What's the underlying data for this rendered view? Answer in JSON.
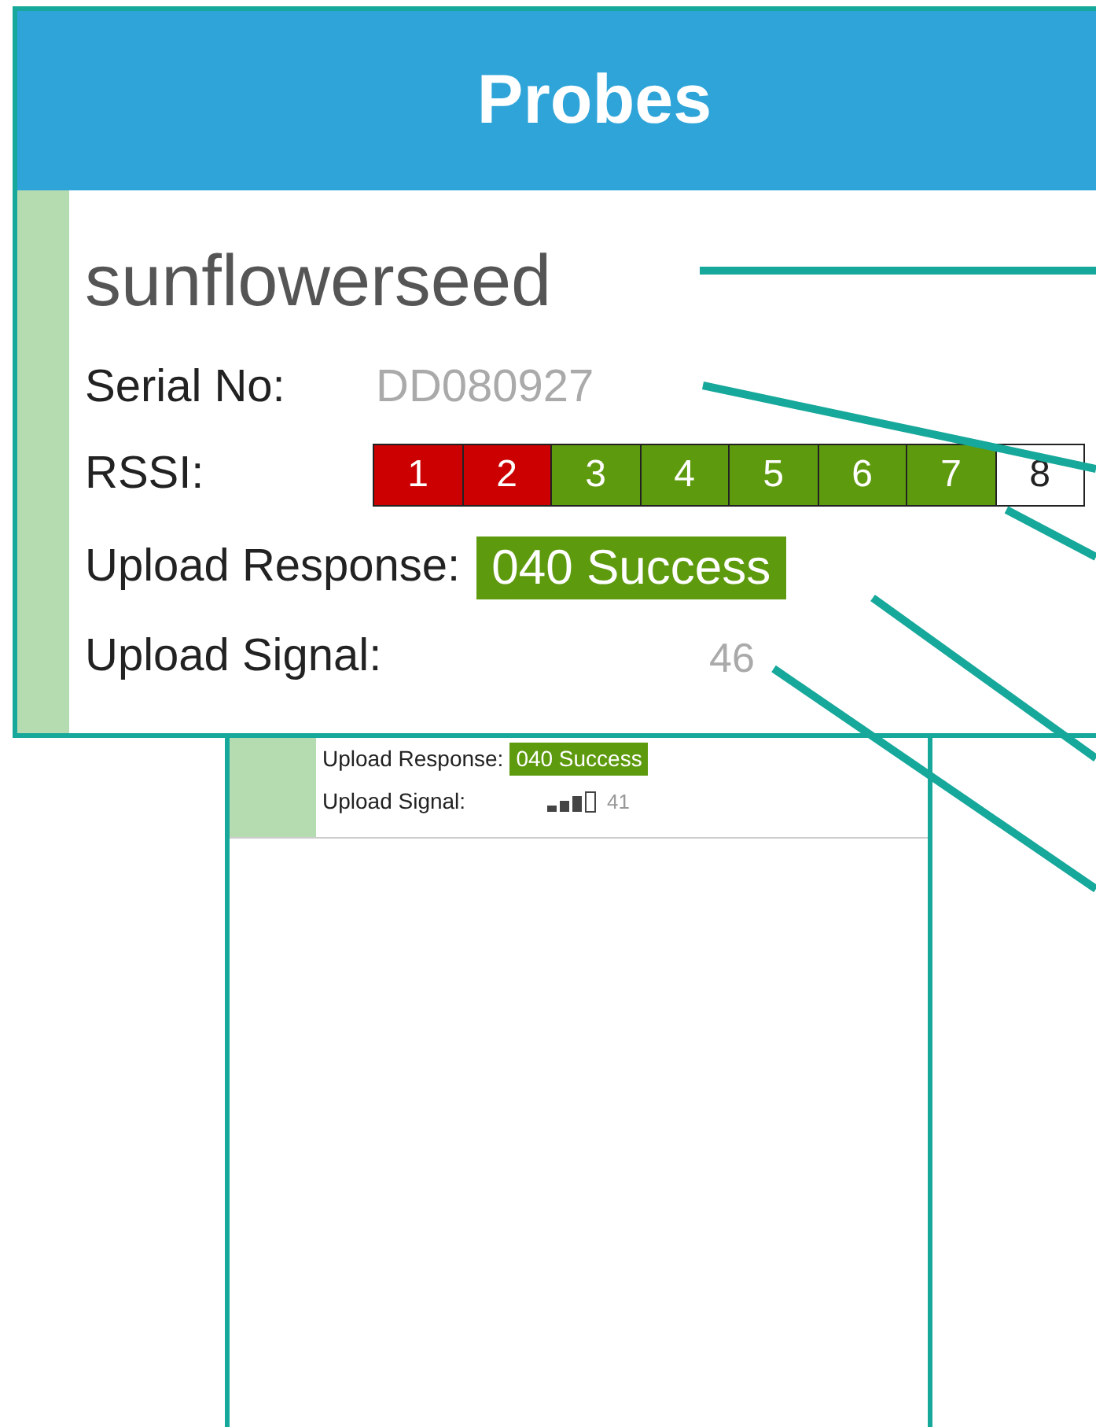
{
  "callout": {
    "title": "Probes",
    "probe": {
      "name": "sunflowerseed",
      "serial_label": "Serial No:",
      "serial": "DD080927",
      "rssi_label": "RSSI:",
      "rssi_cells": [
        {
          "label": "1",
          "color": "#cc0000"
        },
        {
          "label": "2",
          "color": "#cc0000"
        },
        {
          "label": "3",
          "color": "#5e9a0e"
        },
        {
          "label": "4",
          "color": "#5e9a0e"
        },
        {
          "label": "5",
          "color": "#5e9a0e"
        },
        {
          "label": "6",
          "color": "#5e9a0e"
        },
        {
          "label": "7",
          "color": "#5e9a0e"
        },
        {
          "label": "8",
          "color": "#ffffff"
        }
      ],
      "upload_response_label": "Upload Response:",
      "upload_response": "040 Success",
      "upload_signal_label": "Upload Signal:",
      "upload_signal": "46"
    }
  },
  "phone": {
    "upload_response_label": "Upload Response:",
    "upload_response": "040 Success",
    "upload_signal_label": "Upload Signal:",
    "upload_signal": "41"
  }
}
